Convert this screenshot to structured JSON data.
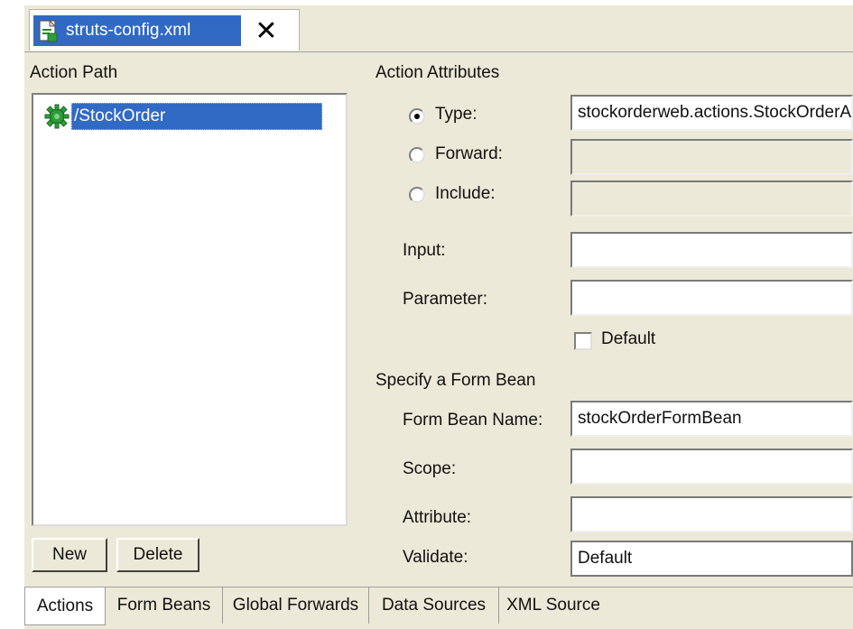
{
  "editor_tab": {
    "title": "struts-config.xml",
    "close_glyph": "✕"
  },
  "action_path": {
    "heading": "Action Path",
    "items": [
      {
        "label": "/StockOrder",
        "icon": "gear-icon",
        "selected": true
      }
    ],
    "new_button": "New",
    "delete_button": "Delete"
  },
  "attributes": {
    "heading": "Action Attributes",
    "type": {
      "label": "Type:",
      "value": "stockorderweb.actions.StockOrderAction",
      "checked": true
    },
    "forward": {
      "label": "Forward:",
      "value": "",
      "checked": false
    },
    "include": {
      "label": "Include:",
      "value": "",
      "checked": false
    },
    "input": {
      "label": "Input:",
      "value": ""
    },
    "parameter": {
      "label": "Parameter:",
      "value": ""
    },
    "default_checkbox": {
      "label": "Default",
      "checked": false
    }
  },
  "form_bean": {
    "heading": "Specify a Form Bean",
    "name": {
      "label": "Form Bean Name:",
      "value": "stockOrderFormBean"
    },
    "scope": {
      "label": "Scope:",
      "value": ""
    },
    "attribute": {
      "label": "Attribute:",
      "value": ""
    },
    "validate": {
      "label": "Validate:",
      "value": "Default"
    }
  },
  "page_tabs": [
    "Actions",
    "Form Beans",
    "Global Forwards",
    "Data Sources",
    "XML Source"
  ],
  "colors": {
    "selection": "#316ac5",
    "panel": "#ece9d8",
    "border": "#7f7f7f"
  }
}
